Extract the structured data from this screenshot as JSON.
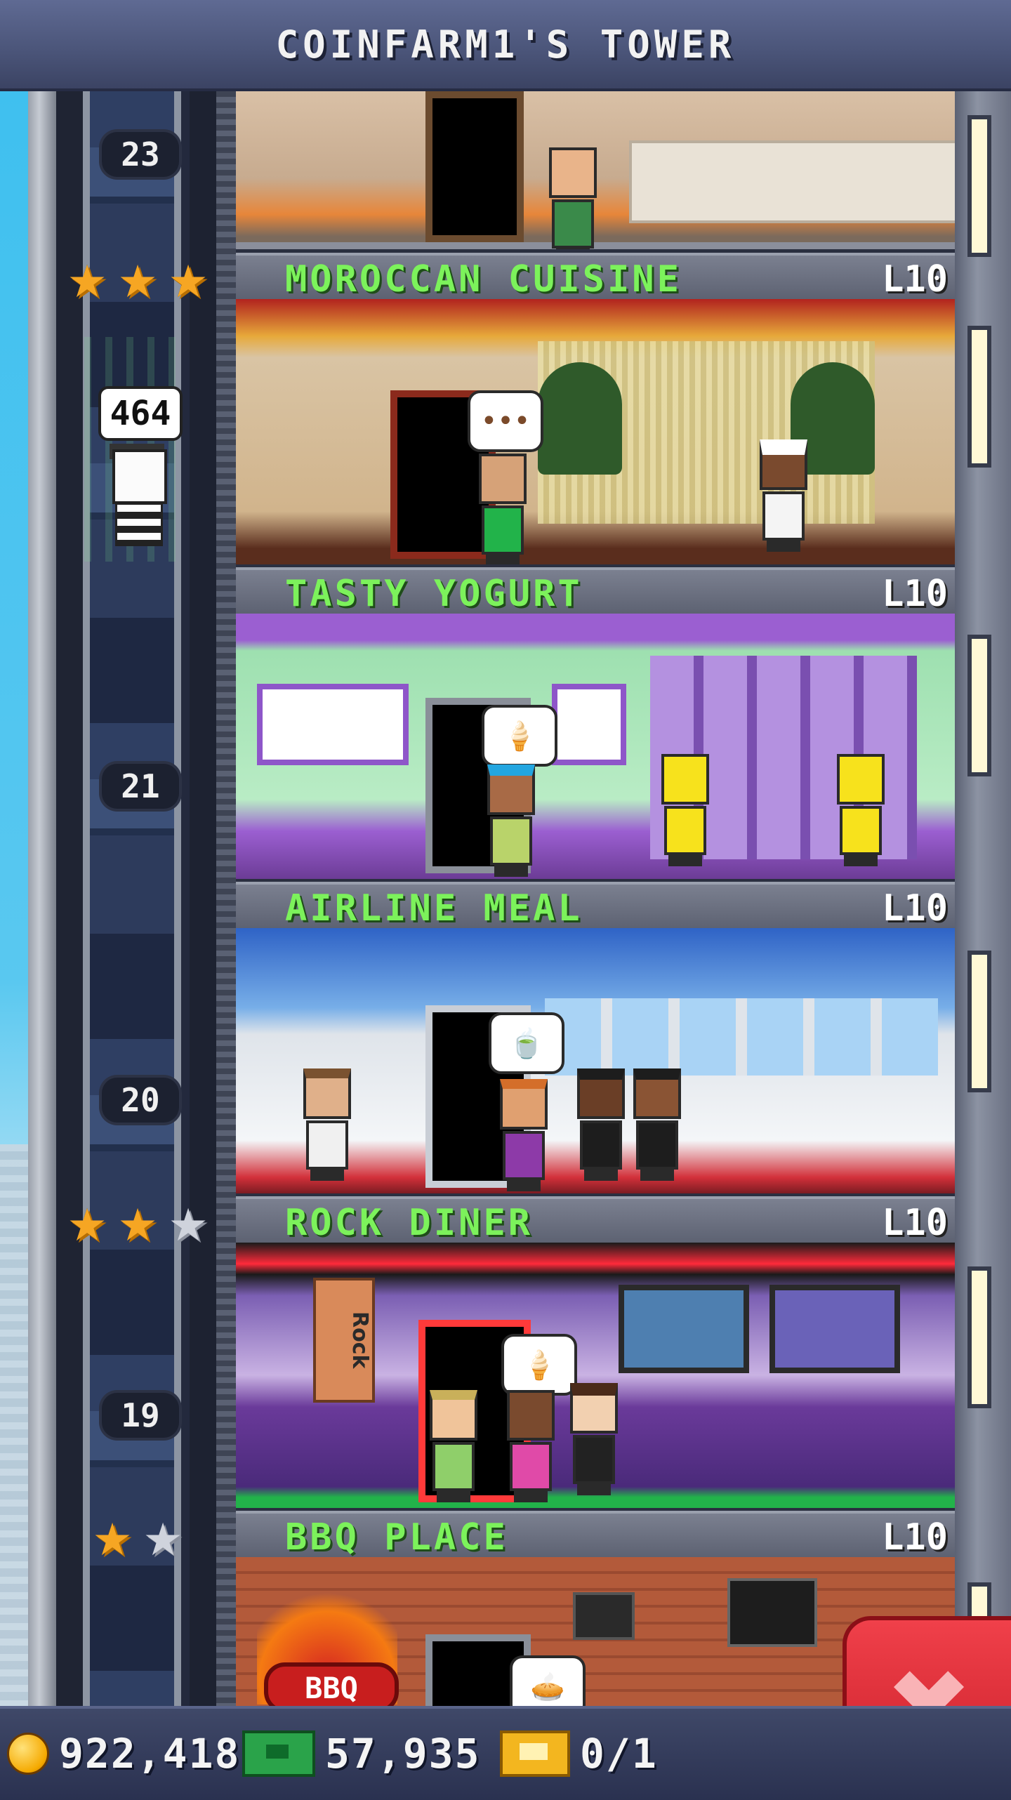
{
  "header": {
    "title": "COINFARM1'S TOWER"
  },
  "elevator": {
    "passenger_count": "464",
    "floor_numbers": [
      "23",
      "21",
      "20",
      "19"
    ]
  },
  "floors": [
    {
      "name": "MOROCCAN CUISINE",
      "level": "L10",
      "stars": [
        "gold",
        "gold",
        "gold"
      ]
    },
    {
      "name": "TASTY YOGURT",
      "level": "L10",
      "stars": []
    },
    {
      "name": "AIRLINE MEAL",
      "level": "L10",
      "stars": []
    },
    {
      "name": "ROCK DINER",
      "level": "L10",
      "stars": [
        "gold",
        "gold",
        "silver"
      ]
    },
    {
      "name": "BBQ PLACE",
      "level": "L10",
      "stars": [
        "gold",
        "silver"
      ]
    }
  ],
  "signs": {
    "rock": "Rock",
    "bbq": "BBQ"
  },
  "resources": {
    "coins": "922,418",
    "bux": "57,935",
    "tickets": "0/1"
  },
  "icons": {
    "coin": "coin-icon",
    "bux": "bux-icon",
    "ticket": "ticket-icon",
    "close": "close-icon",
    "star": "star-icon"
  },
  "colors": {
    "floor_name": "#7cf25b",
    "header_bg": "#4a5478",
    "close_button": "#e0303a",
    "star_gold": "#f6a623",
    "star_silver": "#cfd3dc"
  }
}
